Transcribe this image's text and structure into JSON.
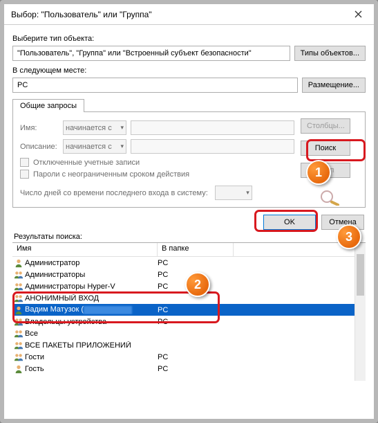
{
  "titlebar": {
    "title": "Выбор: \"Пользователь\" или \"Группа\""
  },
  "labels": {
    "select_type": "Выберите тип объекта:",
    "in_location": "В следующем месте:",
    "common_queries_tab": "Общие запросы",
    "name": "Имя:",
    "description": "Описание:",
    "starts_with": "начинается с",
    "disabled_accounts": "Отключенные учетные записи",
    "non_expiring_pwd": "Пароли с неограниченным сроком действия",
    "days_since_login": "Число дней со времени последнего входа в систему:",
    "results": "Результаты поиска:",
    "col_name": "Имя",
    "col_folder": "В папке"
  },
  "fields": {
    "object_types_value": "\"Пользователь\", \"Группа\" или \"Встроенный субъект безопасности\"",
    "location_value": "PC"
  },
  "buttons": {
    "object_types": "Типы объектов...",
    "locations": "Размещение...",
    "columns": "Столбцы...",
    "find_now": "Поиск",
    "stop": "Стоп",
    "ok": "OK",
    "cancel": "Отмена"
  },
  "results_list": [
    {
      "icon": "user",
      "name": "Администратор",
      "folder": "PC"
    },
    {
      "icon": "group",
      "name": "Администраторы",
      "folder": "PC"
    },
    {
      "icon": "group",
      "name": "Администраторы Hyper-V",
      "folder": "PC"
    },
    {
      "icon": "group",
      "name": "АНОНИМНЫЙ ВХОД",
      "folder": ""
    },
    {
      "icon": "user",
      "name": "Вадим Матузок (",
      "folder": "PC",
      "selected": true,
      "blurred_suffix": true
    },
    {
      "icon": "group",
      "name": "Владельцы устройства",
      "folder": "PC"
    },
    {
      "icon": "group",
      "name": "Все",
      "folder": ""
    },
    {
      "icon": "group",
      "name": "ВСЕ ПАКЕТЫ ПРИЛОЖЕНИЙ",
      "folder": ""
    },
    {
      "icon": "group",
      "name": "Гости",
      "folder": "PC"
    },
    {
      "icon": "user",
      "name": "Гость",
      "folder": "PC"
    }
  ],
  "annotations": {
    "badge1": "1",
    "badge2": "2",
    "badge3": "3"
  }
}
